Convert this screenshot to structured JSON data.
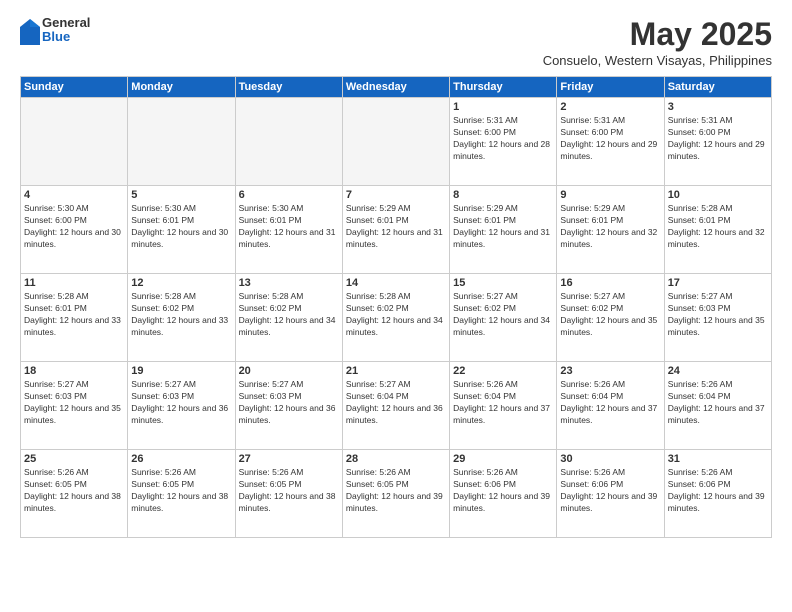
{
  "header": {
    "logo": {
      "line1": "General",
      "line2": "Blue"
    },
    "title": "May 2025",
    "location": "Consuelo, Western Visayas, Philippines"
  },
  "weekdays": [
    "Sunday",
    "Monday",
    "Tuesday",
    "Wednesday",
    "Thursday",
    "Friday",
    "Saturday"
  ],
  "weeks": [
    [
      {
        "day": "",
        "empty": true
      },
      {
        "day": "",
        "empty": true
      },
      {
        "day": "",
        "empty": true
      },
      {
        "day": "",
        "empty": true
      },
      {
        "day": "1",
        "sunrise": "5:31 AM",
        "sunset": "6:00 PM",
        "daylight": "12 hours and 28 minutes."
      },
      {
        "day": "2",
        "sunrise": "5:31 AM",
        "sunset": "6:00 PM",
        "daylight": "12 hours and 29 minutes."
      },
      {
        "day": "3",
        "sunrise": "5:31 AM",
        "sunset": "6:00 PM",
        "daylight": "12 hours and 29 minutes."
      }
    ],
    [
      {
        "day": "4",
        "sunrise": "5:30 AM",
        "sunset": "6:00 PM",
        "daylight": "12 hours and 30 minutes."
      },
      {
        "day": "5",
        "sunrise": "5:30 AM",
        "sunset": "6:01 PM",
        "daylight": "12 hours and 30 minutes."
      },
      {
        "day": "6",
        "sunrise": "5:30 AM",
        "sunset": "6:01 PM",
        "daylight": "12 hours and 31 minutes."
      },
      {
        "day": "7",
        "sunrise": "5:29 AM",
        "sunset": "6:01 PM",
        "daylight": "12 hours and 31 minutes."
      },
      {
        "day": "8",
        "sunrise": "5:29 AM",
        "sunset": "6:01 PM",
        "daylight": "12 hours and 31 minutes."
      },
      {
        "day": "9",
        "sunrise": "5:29 AM",
        "sunset": "6:01 PM",
        "daylight": "12 hours and 32 minutes."
      },
      {
        "day": "10",
        "sunrise": "5:28 AM",
        "sunset": "6:01 PM",
        "daylight": "12 hours and 32 minutes."
      }
    ],
    [
      {
        "day": "11",
        "sunrise": "5:28 AM",
        "sunset": "6:01 PM",
        "daylight": "12 hours and 33 minutes."
      },
      {
        "day": "12",
        "sunrise": "5:28 AM",
        "sunset": "6:02 PM",
        "daylight": "12 hours and 33 minutes."
      },
      {
        "day": "13",
        "sunrise": "5:28 AM",
        "sunset": "6:02 PM",
        "daylight": "12 hours and 34 minutes."
      },
      {
        "day": "14",
        "sunrise": "5:28 AM",
        "sunset": "6:02 PM",
        "daylight": "12 hours and 34 minutes."
      },
      {
        "day": "15",
        "sunrise": "5:27 AM",
        "sunset": "6:02 PM",
        "daylight": "12 hours and 34 minutes."
      },
      {
        "day": "16",
        "sunrise": "5:27 AM",
        "sunset": "6:02 PM",
        "daylight": "12 hours and 35 minutes."
      },
      {
        "day": "17",
        "sunrise": "5:27 AM",
        "sunset": "6:03 PM",
        "daylight": "12 hours and 35 minutes."
      }
    ],
    [
      {
        "day": "18",
        "sunrise": "5:27 AM",
        "sunset": "6:03 PM",
        "daylight": "12 hours and 35 minutes."
      },
      {
        "day": "19",
        "sunrise": "5:27 AM",
        "sunset": "6:03 PM",
        "daylight": "12 hours and 36 minutes."
      },
      {
        "day": "20",
        "sunrise": "5:27 AM",
        "sunset": "6:03 PM",
        "daylight": "12 hours and 36 minutes."
      },
      {
        "day": "21",
        "sunrise": "5:27 AM",
        "sunset": "6:04 PM",
        "daylight": "12 hours and 36 minutes."
      },
      {
        "day": "22",
        "sunrise": "5:26 AM",
        "sunset": "6:04 PM",
        "daylight": "12 hours and 37 minutes."
      },
      {
        "day": "23",
        "sunrise": "5:26 AM",
        "sunset": "6:04 PM",
        "daylight": "12 hours and 37 minutes."
      },
      {
        "day": "24",
        "sunrise": "5:26 AM",
        "sunset": "6:04 PM",
        "daylight": "12 hours and 37 minutes."
      }
    ],
    [
      {
        "day": "25",
        "sunrise": "5:26 AM",
        "sunset": "6:05 PM",
        "daylight": "12 hours and 38 minutes."
      },
      {
        "day": "26",
        "sunrise": "5:26 AM",
        "sunset": "6:05 PM",
        "daylight": "12 hours and 38 minutes."
      },
      {
        "day": "27",
        "sunrise": "5:26 AM",
        "sunset": "6:05 PM",
        "daylight": "12 hours and 38 minutes."
      },
      {
        "day": "28",
        "sunrise": "5:26 AM",
        "sunset": "6:05 PM",
        "daylight": "12 hours and 39 minutes."
      },
      {
        "day": "29",
        "sunrise": "5:26 AM",
        "sunset": "6:06 PM",
        "daylight": "12 hours and 39 minutes."
      },
      {
        "day": "30",
        "sunrise": "5:26 AM",
        "sunset": "6:06 PM",
        "daylight": "12 hours and 39 minutes."
      },
      {
        "day": "31",
        "sunrise": "5:26 AM",
        "sunset": "6:06 PM",
        "daylight": "12 hours and 39 minutes."
      }
    ]
  ]
}
